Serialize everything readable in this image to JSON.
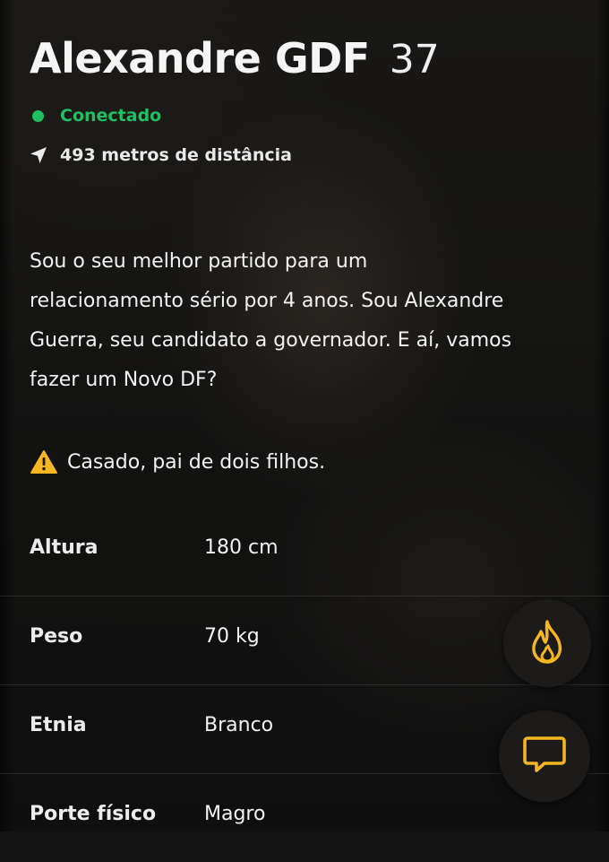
{
  "profile": {
    "name": "Alexandre GDF",
    "age": "37",
    "status": "Conectado",
    "distance": "493 metros de distância",
    "bio": "Sou o seu melhor partido para um\nrelacionamento sério por 4 anos. Sou Alexandre\nGuerra, seu candidato a governador. E aí, vamos\nfazer um Novo DF?",
    "warning": "Casado, pai de dois filhos."
  },
  "details": [
    {
      "label": "Altura",
      "value": "180 cm"
    },
    {
      "label": "Peso",
      "value": "70 kg"
    },
    {
      "label": "Etnia",
      "value": "Branco"
    },
    {
      "label": "Porte físico",
      "value": "Magro"
    }
  ],
  "icons": {
    "status": "online-dot-icon",
    "distance": "location-arrow-icon",
    "warning": "warning-triangle-icon",
    "fire_button": "fire-icon",
    "chat_button": "chat-icon"
  },
  "colors": {
    "online": "#1fbf62",
    "accent": "#f5b621",
    "background": "#131313"
  }
}
